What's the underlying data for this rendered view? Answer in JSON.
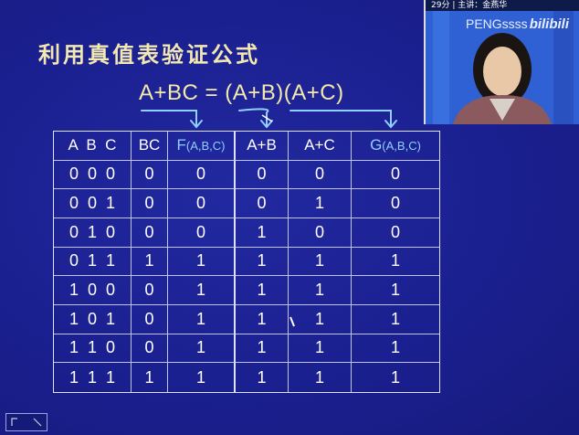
{
  "slide": {
    "title": "利用真值表验证公式",
    "formula": "A+BC = (A+B)(A+C)"
  },
  "table": {
    "headers": [
      {
        "main": "A  B  C",
        "sub": ""
      },
      {
        "main": "BC",
        "sub": ""
      },
      {
        "main": "F",
        "sub": "(A,B,C)"
      },
      {
        "main": "A+B",
        "sub": ""
      },
      {
        "main": "A+C",
        "sub": ""
      },
      {
        "main": "G",
        "sub": "(A,B,C)"
      }
    ],
    "rows": [
      [
        "0  0  0",
        "0",
        "0",
        "0",
        "0",
        "0"
      ],
      [
        "0  0  1",
        "0",
        "0",
        "0",
        "1",
        "0"
      ],
      [
        "0  1  0",
        "0",
        "0",
        "1",
        "0",
        "0"
      ],
      [
        "0  1  1",
        "1",
        "1",
        "1",
        "1",
        "1"
      ],
      [
        "1  0  0",
        "0",
        "1",
        "1",
        "1",
        "1"
      ],
      [
        "1  0  1",
        "0",
        "1",
        "1",
        "1",
        "1"
      ],
      [
        "1  1  0",
        "0",
        "1",
        "1",
        "1",
        "1"
      ],
      [
        "1  1  1",
        "1",
        "1",
        "1",
        "1",
        "1"
      ]
    ]
  },
  "webcam": {
    "caption": "29分 | 主讲：金燕华",
    "watermark": "PENGssss",
    "logo": "bilibili"
  },
  "colors": {
    "background": "#1a1f8c",
    "title": "#f2e8b0",
    "accent": "#8fd0ff",
    "grid": "#dfe2ff"
  }
}
